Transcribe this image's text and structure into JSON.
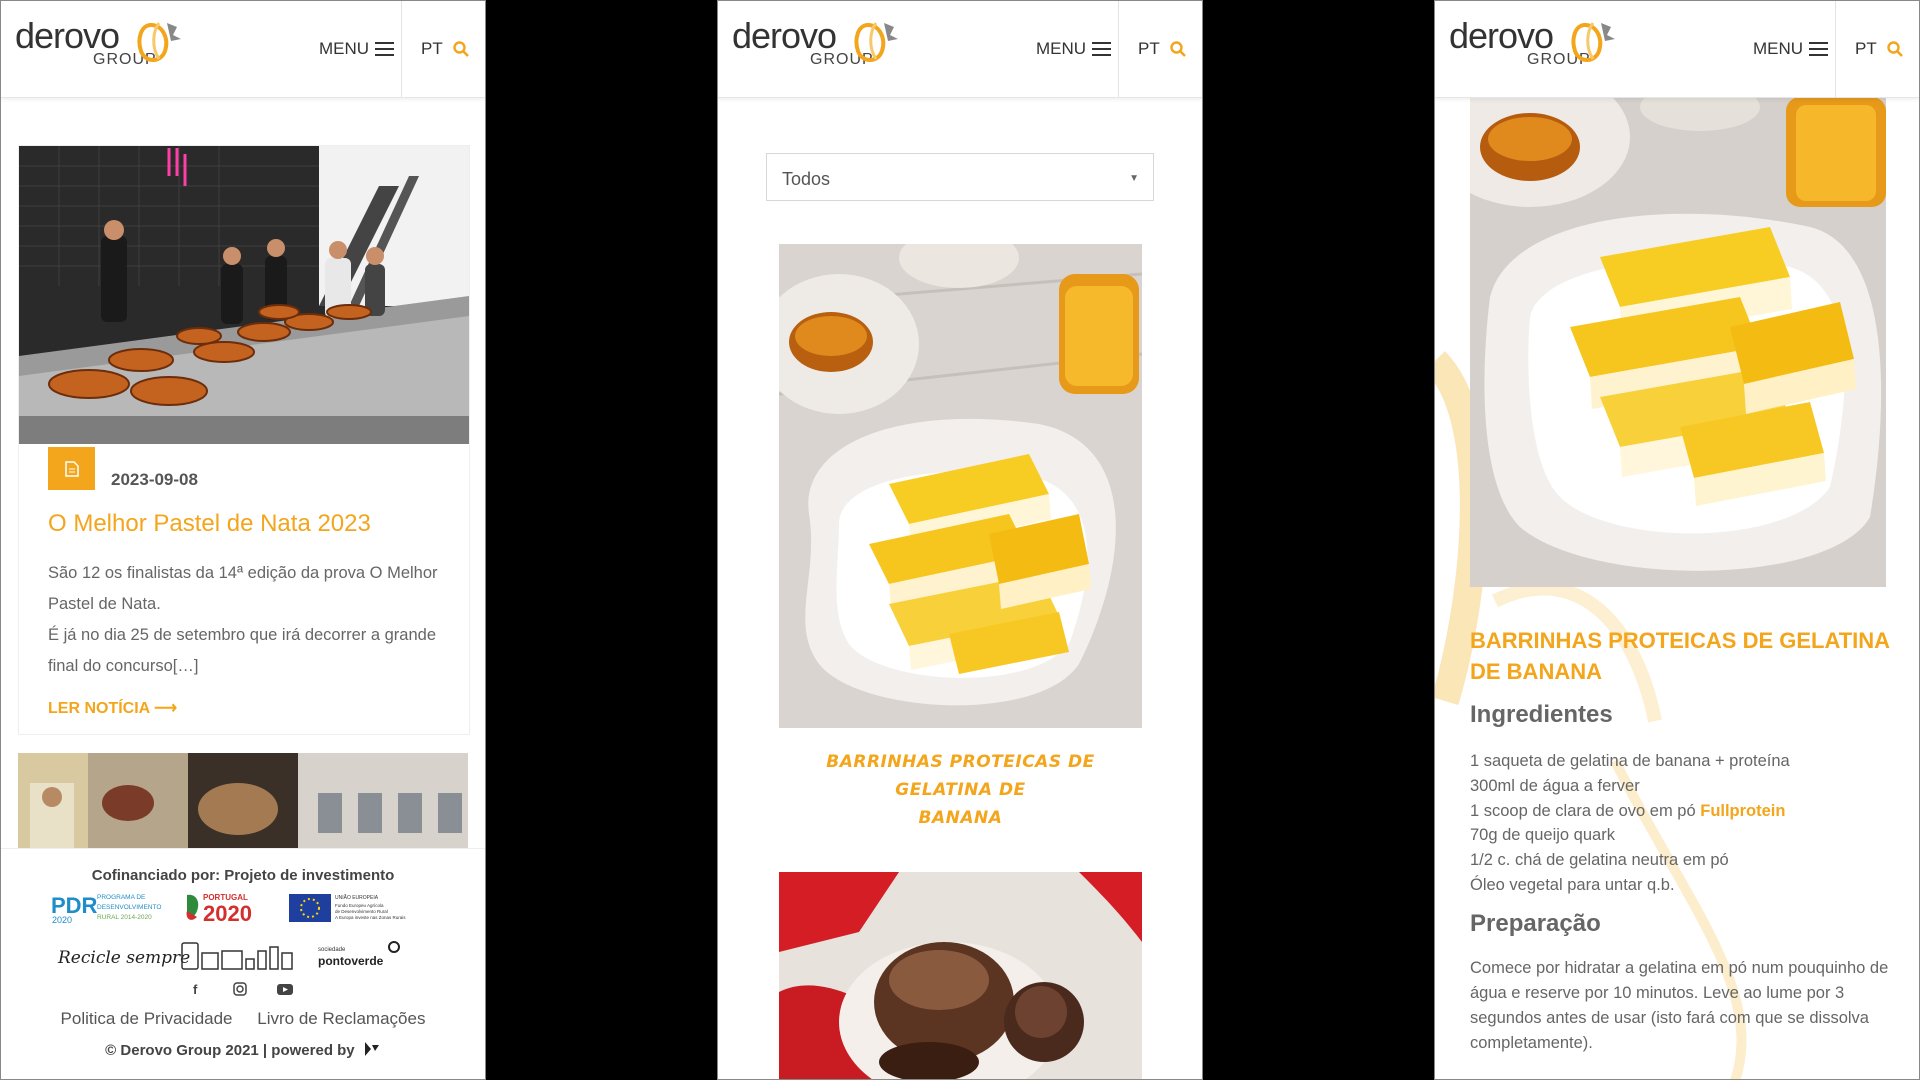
{
  "brand": {
    "name": "derovo",
    "sub": "GROUP",
    "accent": "#f3a51c"
  },
  "header": {
    "menu_label": "MENU",
    "lang_label": "PT"
  },
  "panel1": {
    "news": {
      "date": "2023-09-08",
      "title": "O Melhor Pastel de Nata 2023",
      "excerpt_line1": "São 12 os finalistas da 14ª edição da prova O Melhor Pastel de Nata.",
      "excerpt_line2": "É já no dia 25 de setembro que irá decorrer a grande final do concurso[…]",
      "read_more": "LER NOTÍCIA ⟶"
    },
    "footer": {
      "cofinanced": "Cofinanciado por: Projeto de investimento",
      "privacy": "Politica de Privacidade",
      "complaints": "Livro de Reclamações",
      "copyright": "© Derovo Group 2021 | powered by",
      "logos": {
        "pdr_line1": "PROGRAMA DE",
        "pdr_line2": "DESENVOLVIMENTO",
        "pdr_line3": "RURAL 2014-2020",
        "portugal": "PORTUGAL",
        "p2020": "2020",
        "eu_line1": "UNIÃO EUROPEIA",
        "eu_line2": "Fundo Europeu Agrícola",
        "eu_line3": "de Desenvolvimento Rural",
        "eu_line4": "A Europa investe nas Zonas Rurais",
        "recicle": "Recicle sempre",
        "sociedade": "sociedade",
        "pontoverde": "pontoverde"
      }
    }
  },
  "panel2": {
    "filter_value": "Todos",
    "recipe_title_line1": "BARRINHAS PROTEICAS DE GELATINA DE",
    "recipe_title_line2": "BANANA"
  },
  "panel3": {
    "title": "BARRINHAS PROTEICAS DE GELATINA DE BANANA",
    "ingredients_heading": "Ingredientes",
    "ingredients": [
      "1 saqueta de gelatina de banana + proteína",
      "300ml de água a ferver",
      "1 scoop de clara de ovo em pó ",
      "70g de queijo quark",
      "1/2 c. chá de gelatina neutra em pó",
      "Óleo vegetal para untar q.b."
    ],
    "ingredient_link": "Fullprotein",
    "preparation_heading": "Preparação",
    "preparation_text": "Comece por hidratar a gelatina em pó num pouquinho de água e reserve por 10 minutos. Leve ao lume por 3 segundos antes de usar (isto fará com que se dissolva completamente)."
  }
}
